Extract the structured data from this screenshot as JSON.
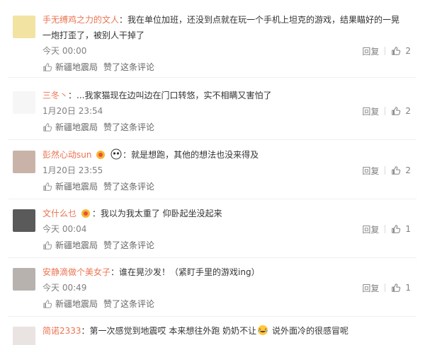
{
  "colors": {
    "name": "#eb7350",
    "muted": "#808080",
    "text": "#333333",
    "link": "#666666"
  },
  "comments": [
    {
      "avatar": "avatar-image",
      "author": "手无缚鸡之力的文人",
      "text_line1": "：我在单位加班，还没到点就在玩一个手机上坦克的游戏，结果瞄好的一晃",
      "text_line2": "一炮打歪了，被别人干掉了",
      "time": "今天 00:00",
      "reply": "回复",
      "likes": "2",
      "shake_tag": "新疆地震局",
      "liked_text": "赞了这条评论"
    },
    {
      "avatar": "avatar-image",
      "author": "三冬丶",
      "text_line1": "：...我家猫现在边叫边在门口转悠，实不相瞒又害怕了",
      "time": "1月20日 23:54",
      "reply": "回复",
      "likes": "2",
      "shake_tag": "新疆地震局",
      "liked_text": "赞了这条评论"
    },
    {
      "avatar": "avatar-image",
      "author": "彭然心动sun",
      "text_line1": "：就是想跑，其他的想法也没来得及",
      "time": "1月20日 23:55",
      "reply": "回复",
      "likes": "2",
      "shake_tag": "新疆地震局",
      "liked_text": "赞了这条评论"
    },
    {
      "avatar": "avatar-image",
      "author": "文什么乜",
      "text_line1": "：我以为我太重了 仰卧起坐没起来",
      "time": "今天 00:04",
      "reply": "回复",
      "likes": "1",
      "shake_tag": "新疆地震局",
      "liked_text": "赞了这条评论"
    },
    {
      "avatar": "avatar-image",
      "author": "安静滴做个美女子",
      "text_line1": "：谁在晃沙发！（紧盯手里的游戏ing）",
      "time": "今天 00:49",
      "reply": "回复",
      "likes": "1",
      "shake_tag": "新疆地震局",
      "liked_text": "赞了这条评论"
    },
    {
      "avatar": "avatar-image",
      "author": "简诺2333",
      "text_line1a": "：第一次感觉到地震哎  本来想往外跑 奶奶不让",
      "text_line1b": " 说外面冷的很感冒呢"
    }
  ]
}
